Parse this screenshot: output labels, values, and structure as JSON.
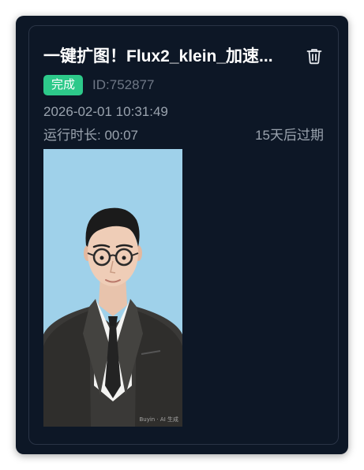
{
  "task": {
    "title": "一键扩图！Flux2_klein_加速...",
    "status_label": "完成",
    "id_label": "ID:752877",
    "created_at": "2026-02-01 10:31:49",
    "runtime_label": "运行时长: 00:07",
    "expiry_label": "15天后过期"
  },
  "result_image": {
    "watermark": "Buyin · AI 生成"
  },
  "icons": {
    "delete": "trash-icon"
  },
  "colors": {
    "panel_bg": "#0d1726",
    "status_success": "#2dc98a",
    "photo_bg": "#9fd1ea"
  }
}
